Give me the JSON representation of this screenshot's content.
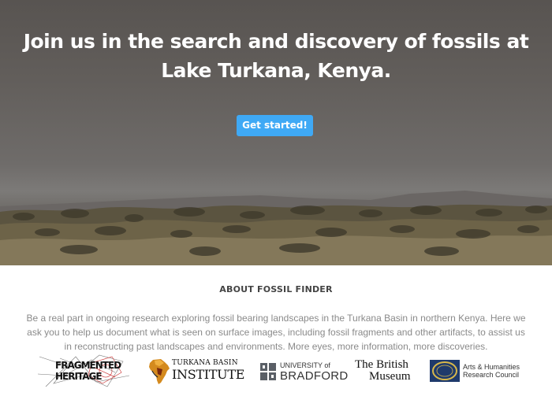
{
  "hero": {
    "title": "Join us in the search and discovery of fossils at Lake Turkana, Kenya.",
    "cta_label": "Get started!",
    "cta_color": "#3fa9f5"
  },
  "about": {
    "heading": "ABOUT FOSSIL FINDER",
    "body": "Be a real part in ongoing research exploring fossil bearing landscapes in the Turkana Basin in northern Kenya. Here we ask you to help us document what is seen on surface images, including fossil fragments and other artifacts, to assist us in reconstructing past landscapes and environments. More eyes, more information, more discoveries."
  },
  "partners": {
    "fragmented": {
      "line1": "FRAGMENTED",
      "line2": "HERITAGE"
    },
    "turkana": {
      "line1": "TURKANA BASIN",
      "line2": "INSTITUTE"
    },
    "bradford": {
      "line1": "UNIVERSITY of",
      "line2": "BRADFORD"
    },
    "british_museum": {
      "line1": "The British",
      "line2": "Museum"
    },
    "ahrc": {
      "line1": "Arts & Humanities",
      "line2": "Research Council"
    }
  }
}
